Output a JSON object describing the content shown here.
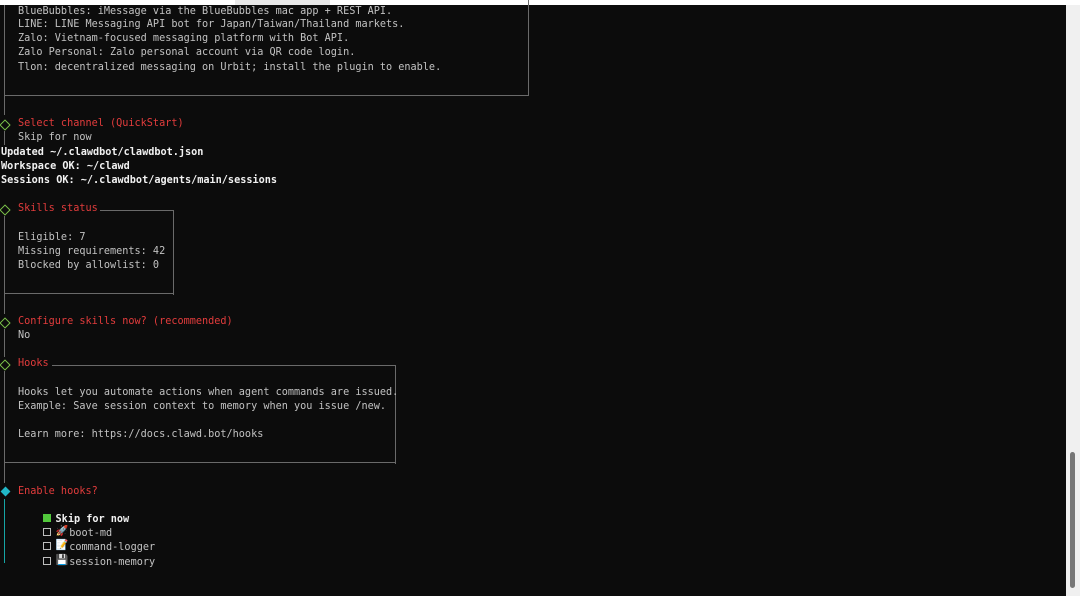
{
  "channels_box": {
    "lines": [
      "BlueBubbles: iMessage via the BlueBubbles mac app + REST API.",
      "LINE: LINE Messaging API bot for Japan/Taiwan/Thailand markets.",
      "Zalo: Vietnam-focused messaging platform with Bot API.",
      "Zalo Personal: Zalo personal account via QR code login.",
      "Tlon: decentralized messaging on Urbit; install the plugin to enable."
    ]
  },
  "select_channel": {
    "title": "Select channel (QuickStart)",
    "answer": "Skip for now"
  },
  "status_lines": [
    "Updated ~/.clawdbot/clawdbot.json",
    "Workspace OK: ~/clawd",
    "Sessions OK: ~/.clawdbot/agents/main/sessions"
  ],
  "skills_status": {
    "title": "Skills status",
    "lines": [
      "Eligible: 7",
      "Missing requirements: 42",
      "Blocked by allowlist: 0"
    ]
  },
  "configure_skills": {
    "title": "Configure skills now? (recommended)",
    "answer": "No"
  },
  "hooks": {
    "title": "Hooks",
    "lines": [
      "Hooks let you automate actions when agent commands are issued.",
      "Example: Save session context to memory when you issue /new.",
      "",
      "Learn more: https://docs.clawd.bot/hooks"
    ]
  },
  "enable_hooks": {
    "title": "Enable hooks?",
    "options": [
      {
        "label": "Skip for now",
        "checked": true,
        "icon": ""
      },
      {
        "label": "boot-md",
        "checked": false,
        "icon": "rocket-icon",
        "glyph": "🚀"
      },
      {
        "label": "command-logger",
        "checked": false,
        "icon": "memo-icon",
        "glyph": "📝"
      },
      {
        "label": "session-memory",
        "checked": false,
        "icon": "floppy-disk-icon",
        "glyph": "💾"
      }
    ]
  },
  "colors": {
    "title_red": "#e23c3c",
    "done_green": "#7cc24a",
    "active_cyan": "#21b8c8",
    "checked_green": "#52c83c"
  }
}
